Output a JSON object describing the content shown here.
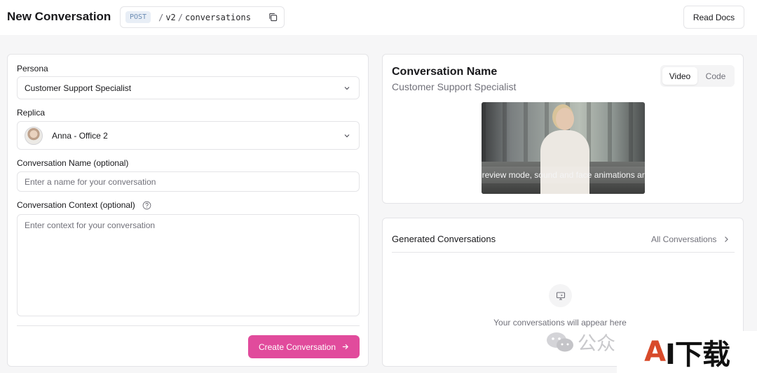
{
  "header": {
    "title": "New Conversation",
    "method": "POST",
    "path_segments": [
      "v2",
      "conversations"
    ],
    "read_docs_label": "Read Docs"
  },
  "form": {
    "persona": {
      "label": "Persona",
      "value": "Customer Support Specialist"
    },
    "replica": {
      "label": "Replica",
      "value": "Anna - Office 2"
    },
    "conversation_name": {
      "label": "Conversation Name (optional)",
      "placeholder": "Enter a name for your conversation",
      "value": ""
    },
    "conversation_context": {
      "label": "Conversation Context (optional)",
      "placeholder": "Enter context for your conversation",
      "value": ""
    },
    "create_label": "Create Conversation"
  },
  "preview": {
    "title": "Conversation Name",
    "subtitle": "Customer Support Specialist",
    "tabs": [
      "Video",
      "Code"
    ],
    "active_tab": "Video",
    "video_overlay": "review mode, sound and face animations are"
  },
  "generated": {
    "title": "Generated Conversations",
    "all_link": "All Conversations",
    "empty_text": "Your conversations will appear here"
  },
  "watermark": {
    "text": "公众",
    "badge_a": "A",
    "badge_rest": "I下载"
  },
  "colors": {
    "accent": "#e14b9c",
    "method_bg": "#e8eef6",
    "method_text": "#6b8bb3"
  },
  "icons": [
    "copy-icon",
    "chevron-down-icon",
    "help-icon",
    "arrow-right-icon",
    "chevron-right-icon",
    "monitor-icon",
    "wechat-icon"
  ]
}
